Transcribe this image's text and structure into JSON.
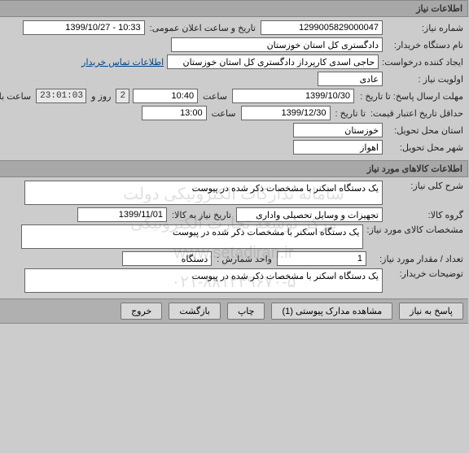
{
  "section1": {
    "title": "اطلاعات نیاز",
    "niaz_no": {
      "label": "شماره نیاز:",
      "value": "1299005829000047"
    },
    "public_dt": {
      "label": "تاریخ و ساعت اعلان عمومی:",
      "value": "10:33 - 1399/10/27"
    },
    "buyer_name": {
      "label": "نام دستگاه خریدار:",
      "value": "دادگستری کل استان خوزستان"
    },
    "requester": {
      "label": "ایجاد کننده درخواست:",
      "value": "حاجی اسدی کارپرداز دادگستری کل استان خوزستان"
    },
    "contact_link": "اطلاعات تماس خریدار",
    "priority": {
      "label": "اولویت نیاز :",
      "value": "عادی"
    },
    "deadline": {
      "label": "مهلت ارسال پاسخ:  تا تاریخ :",
      "date": "1399/10/30",
      "time_label": "ساعت",
      "time": "10:40"
    },
    "remaining": {
      "days_val": "2",
      "days_label": "روز و",
      "time_val": "23:01:03",
      "suffix": "ساعت باقی مانده"
    },
    "validity": {
      "label": "حداقل تاریخ اعتبار قیمت:",
      "sub": "تا تاریخ :",
      "date": "1399/12/30",
      "time_label": "ساعت",
      "time": "13:00"
    },
    "province": {
      "label": "استان محل تحویل:",
      "value": "خوزستان"
    },
    "city": {
      "label": "شهر محل تحویل:",
      "value": "اهواز"
    }
  },
  "section2": {
    "title": "اطلاعات کالاهای مورد نیاز",
    "summary": {
      "label": "شرح کلی نیاز:",
      "value": "یک دستگاه اسکنر با مشخصات ذکر شده در پیوست"
    },
    "group": {
      "label": "گروه کالا:",
      "value": "تجهیزات و وسایل تحصیلی واداری"
    },
    "need_date": {
      "label": "تاریخ نیاز به کالا:",
      "value": "1399/11/01"
    },
    "spec": {
      "label": "مشخصات کالای مورد نیاز:",
      "value": "یک دستگاه اسکنر با مشخصات ذکر شده در پیوست"
    },
    "qty": {
      "label": "تعداد / مقدار مورد نیاز:",
      "value": "1",
      "unit_label": "واحد شمارش :",
      "unit_value": "دستگاه"
    },
    "notes": {
      "label": "توضیحات خریدار:",
      "value": "یک دستگاه اسکنر با مشخصات ذکر شده در پیوست"
    }
  },
  "watermark": {
    "line1": "سامانه تدارکات الکترونیکی دولت",
    "line2": "مرکز توسعه تجارت الکترونیکی",
    "line3": "www.setadiran.ir",
    "line4": "۰۲۱-۸۸۱۲۴۹۶۷۰-۵"
  },
  "buttons": {
    "reply": "پاسخ به نیاز",
    "attachments": "مشاهده مدارک پیوستی (1)",
    "print": "چاپ",
    "back": "بازگشت",
    "exit": "خروج"
  }
}
